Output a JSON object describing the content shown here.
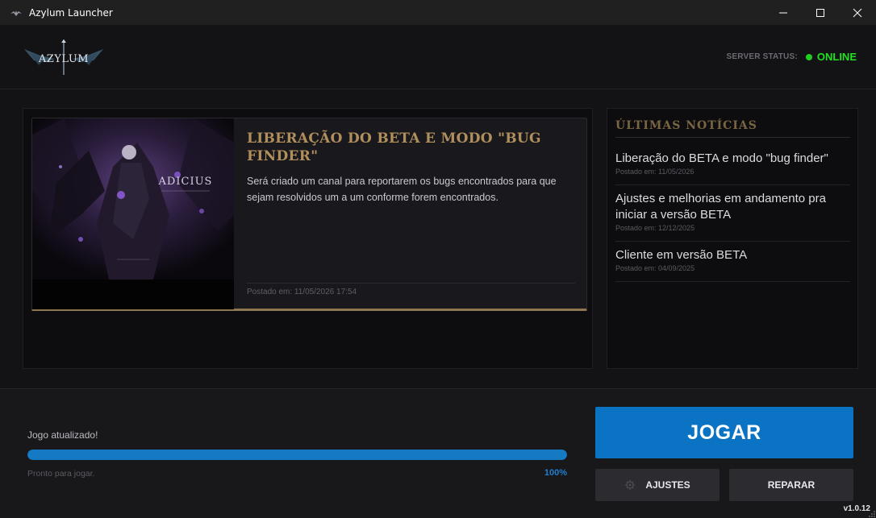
{
  "window": {
    "title": "Azylum Launcher"
  },
  "header": {
    "logo_text": "AZYLUM",
    "server_status_label": "SERVER STATUS:",
    "server_status_value": "ONLINE",
    "status_color": "#22e022"
  },
  "featured": {
    "image_caption": "ADICIUS",
    "title": "Liberação do BETA e modo \"bug finder\"",
    "text": "Será criado um canal para reportarem os bugs encontrados para que sejam resolvidos um a um conforme forem encontrados.",
    "date": "Postado em: 11/05/2026 17:54"
  },
  "latest": {
    "header": "Últimas Notícias",
    "items": [
      {
        "title": "Liberação do BETA e modo \"bug finder\"",
        "date": "Postado em: 11/05/2026"
      },
      {
        "title": "Ajustes e melhorias em andamento pra iniciar a versão BETA",
        "date": "Postado em: 12/12/2025"
      },
      {
        "title": "Cliente em versão BETA",
        "date": "Postado em: 04/09/2025"
      }
    ]
  },
  "footer": {
    "update_label": "Jogo atualizado!",
    "ready_label": "Pronto para jogar.",
    "progress_text": "100%",
    "progress_value": 100,
    "play_label": "JOGAR",
    "settings_label": "AJUSTES",
    "repair_label": "REPARAR",
    "version": "v1.0.12",
    "accent": "#0a73c4"
  }
}
